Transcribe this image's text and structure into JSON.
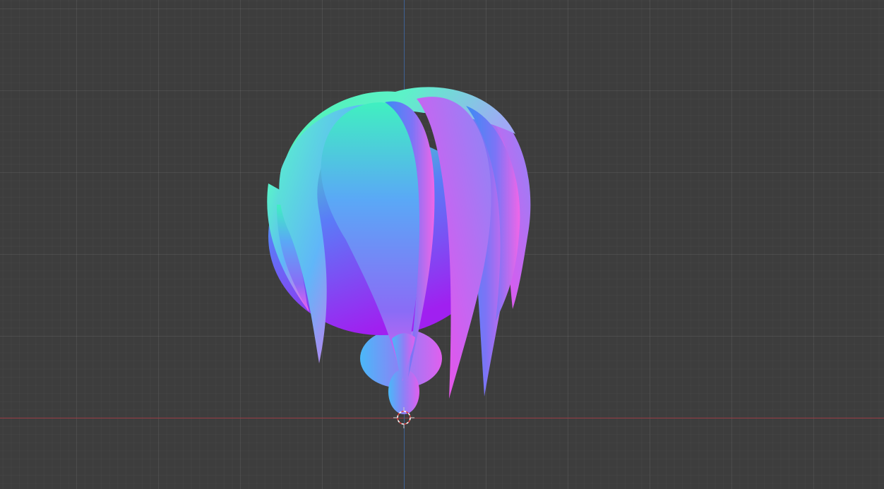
{
  "viewport": {
    "background_color": "#3d3d3d",
    "grid_color": "#4a4a4a",
    "x_axis_color": "#9a3c45",
    "z_axis_color": "#3f6193"
  },
  "object": {
    "shading": "normal-map",
    "description_icon": "hair-mesh-icon"
  },
  "cursor": {
    "icon": "3d-cursor-icon",
    "colors": [
      "#ffffff",
      "#e04040"
    ]
  }
}
